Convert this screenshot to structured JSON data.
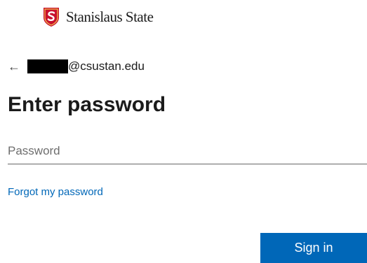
{
  "brand": {
    "name": "Stanislaus State",
    "logo_icon": "shield-s-icon",
    "logo_color": "#c8102e"
  },
  "identity": {
    "back_icon": "←",
    "email_suffix": "@csustan.edu"
  },
  "title": "Enter password",
  "password": {
    "value": "",
    "placeholder": "Password"
  },
  "forgot_link": "Forgot my password",
  "signin_button": "Sign in",
  "colors": {
    "accent": "#0067b8",
    "text": "#1b1b1b"
  }
}
